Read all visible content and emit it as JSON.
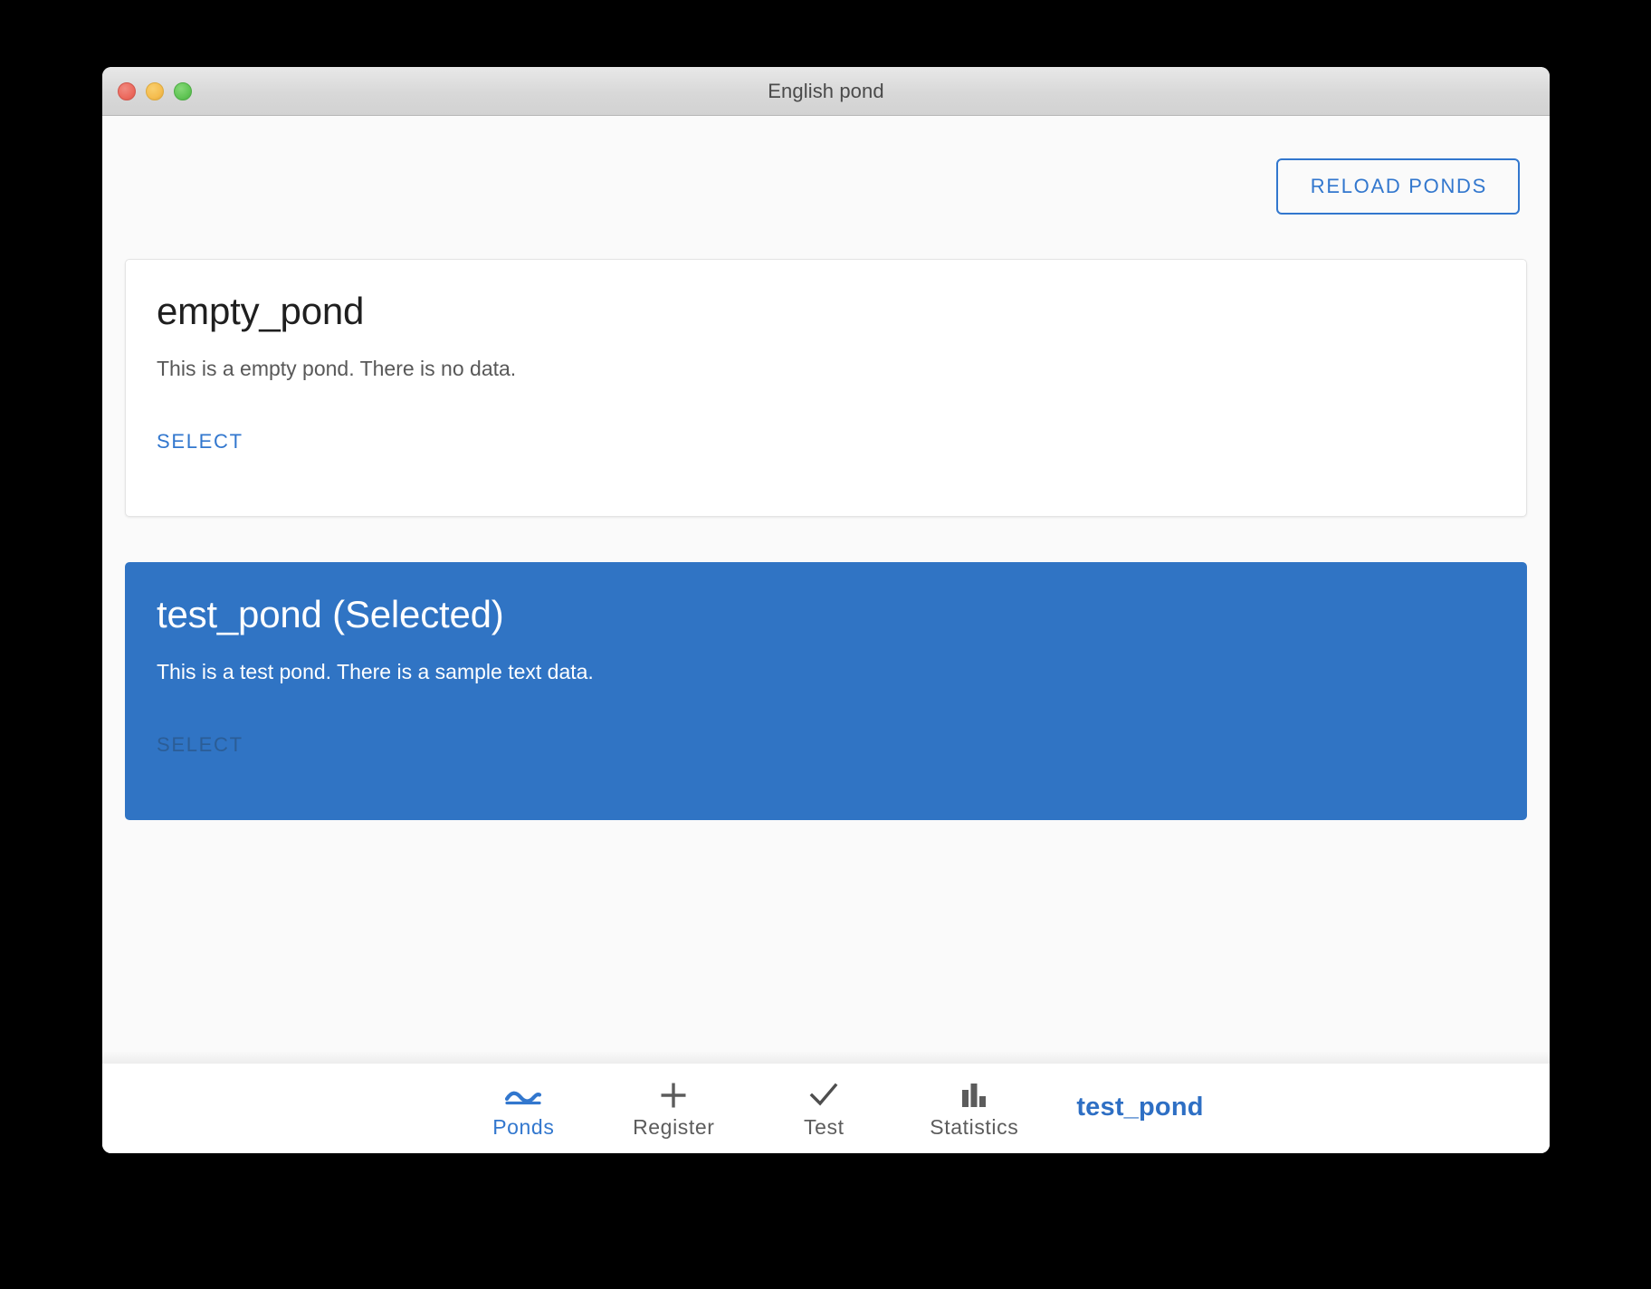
{
  "window": {
    "title": "English pond",
    "controls": [
      {
        "name": "close",
        "color": "#ec6a5e"
      },
      {
        "name": "minimize",
        "color": "#f5bd4f"
      },
      {
        "name": "zoom",
        "color": "#61c555"
      }
    ]
  },
  "toolbar": {
    "reload_label": "RELOAD PONDS"
  },
  "cards": [
    {
      "title": "empty_pond",
      "description": "This is a empty pond. There is no data.",
      "action_label": "SELECT",
      "selected": false
    },
    {
      "title": "test_pond (Selected)",
      "description": "This is a test pond. There is a sample text data.",
      "action_label": "SELECT",
      "selected": true
    }
  ],
  "nav": {
    "items": [
      {
        "label": "Ponds",
        "icon": "wave-icon",
        "active": true
      },
      {
        "label": "Register",
        "icon": "plus-icon",
        "active": false
      },
      {
        "label": "Test",
        "icon": "check-icon",
        "active": false
      },
      {
        "label": "Statistics",
        "icon": "bar-chart-icon",
        "active": false
      }
    ],
    "current_pond": "test_pond"
  },
  "colors": {
    "accent": "#3277ce",
    "selected_card": "#3074c4",
    "content_bg": "#fafafa"
  }
}
